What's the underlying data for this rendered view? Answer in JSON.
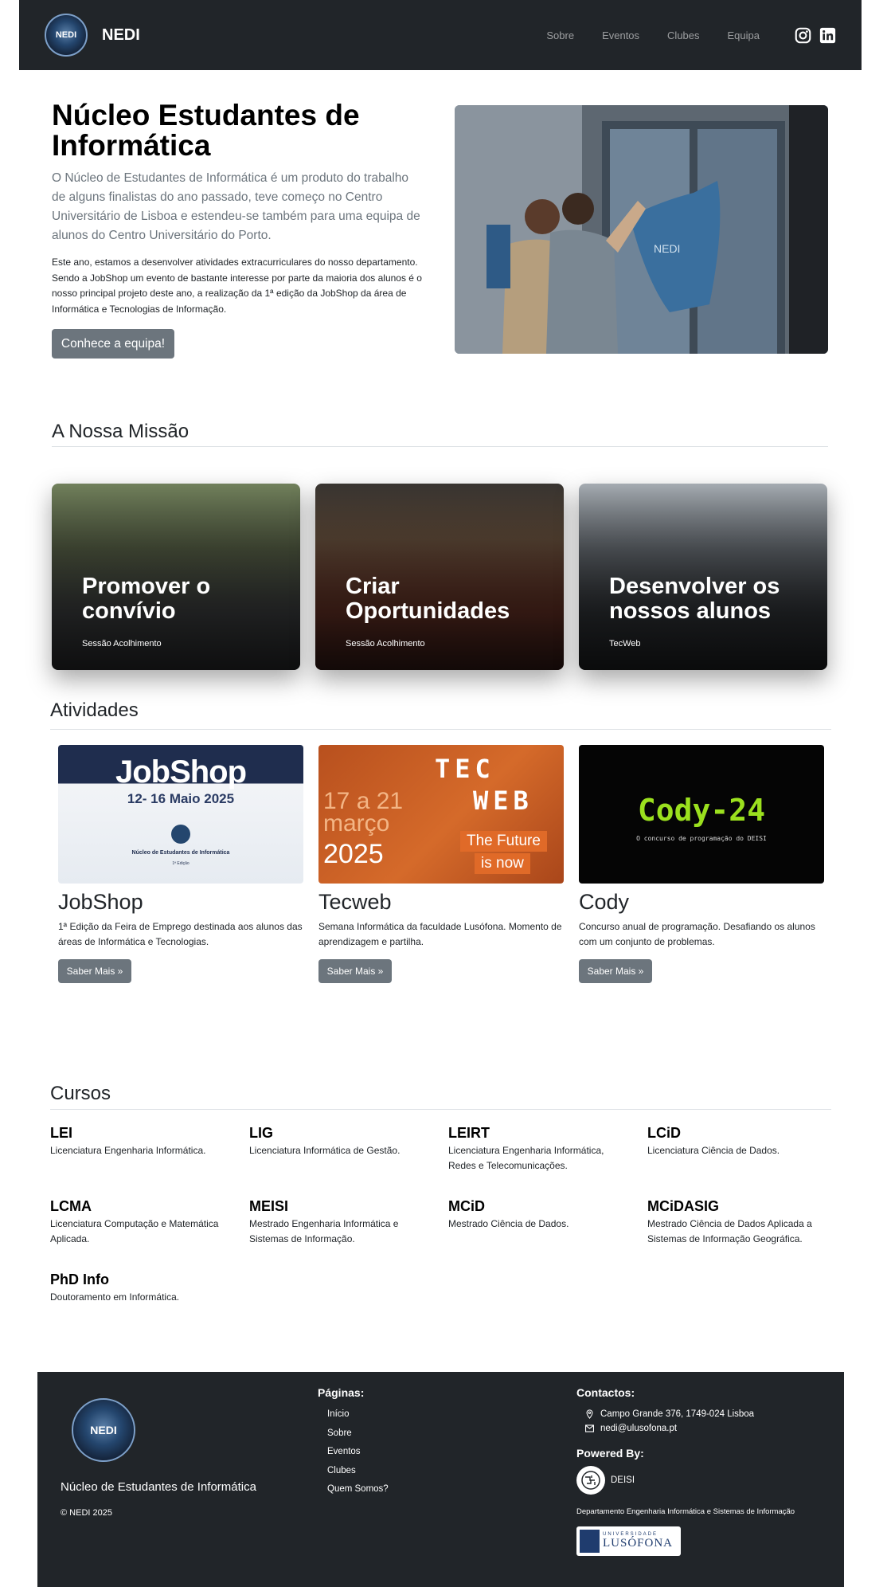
{
  "nav": {
    "logo_text": "NEDI",
    "brand": "NEDI",
    "links": [
      "Sobre",
      "Eventos",
      "Clubes",
      "Equipa"
    ],
    "social_icons": [
      "instagram-icon",
      "linkedin-icon"
    ]
  },
  "hero": {
    "title": "Núcleo Estudantes de Informática",
    "lead": "O Núcleo de Estudantes de Informática é um produto do trabalho de alguns finalistas do ano passado, teve começo no Centro Universitário de Lisboa e estendeu-se também para uma equipa de alunos do Centro Universitário do Porto.",
    "paragraph": "Este ano, estamos a desenvolver atividades extracurriculares do nosso departamento. Sendo a JobShop um evento de bastante interesse por parte da maioria dos alunos é o nosso principal projeto deste ano, a realização da 1ª edição da JobShop da área de Informática e Tecnologias de Informação.",
    "button": "Conhece a equipa!",
    "flag_text": "NEDI"
  },
  "mission": {
    "heading": "A Nossa Missão",
    "cards": [
      {
        "title": "Promover o convívio",
        "caption": "Sessão Acolhimento"
      },
      {
        "title": "Criar Oportunidades",
        "caption": "Sessão Acolhimento"
      },
      {
        "title": "Desenvolver os nossos alunos",
        "caption": "TecWeb"
      }
    ]
  },
  "activities": {
    "heading": "Atividades",
    "cards": [
      {
        "title": "JobShop",
        "desc": "1ª Edição da Feira de Emprego destinada aos alunos das áreas de Informática e Tecnologias.",
        "button": "Saber Mais »"
      },
      {
        "title": "Tecweb",
        "desc": "Semana Informática da faculdade Lusófona. Momento de aprendizagem e partilha.",
        "button": "Saber Mais »"
      },
      {
        "title": "Cody",
        "desc": "Concurso anual de programação. Desafiando os alunos com um conjunto de problemas.",
        "button": "Saber Mais »"
      }
    ],
    "jobshop_img": {
      "title": "JobShop",
      "dates": "12- 16 Maio 2025",
      "org": "Núcleo de Estudantes de Informática",
      "edition": "1ª Edição"
    },
    "tecweb_img": {
      "dates_line1": "17 a 21",
      "dates_line2": "março",
      "year": "2025",
      "tagline1": "The Future",
      "tagline2": "is now",
      "logo_top": "TEC",
      "logo_bottom": "WEB"
    },
    "cody_img": {
      "title": "Cody-24",
      "subtitle": "O concurso de programação do DEISI"
    }
  },
  "courses": {
    "heading": "Cursos",
    "items": [
      {
        "code": "LEI",
        "name": "Licenciatura Engenharia Informática."
      },
      {
        "code": "LIG",
        "name": "Licenciatura Informática de Gestão."
      },
      {
        "code": "LEIRT",
        "name": "Licenciatura Engenharia Informática, Redes e Telecomunicações."
      },
      {
        "code": "LCiD",
        "name": "Licenciatura Ciência de Dados."
      },
      {
        "code": "LCMA",
        "name": "Licenciatura Computação e Matemática Aplicada."
      },
      {
        "code": "MEISI",
        "name": "Mestrado Engenharia Informática e Sistemas de Informação."
      },
      {
        "code": "MCiD",
        "name": "Mestrado Ciência de Dados."
      },
      {
        "code": "MCiDASIG",
        "name": "Mestrado Ciência de Dados Aplicada a Sistemas de Informação Geográfica."
      },
      {
        "code": "PhD Info",
        "name": "Doutoramento em Informática."
      }
    ]
  },
  "footer": {
    "logo_text": "NEDI",
    "name": "Núcleo de Estudantes de Informática",
    "copyright": "© NEDI 2025",
    "pages_heading": "Páginas:",
    "pages": [
      "Início",
      "Sobre",
      "Eventos",
      "Clubes",
      "Quem Somos?"
    ],
    "contacts_heading": "Contactos:",
    "address": "Campo Grande 376, 1749-024 Lisboa",
    "email": "nedi@ulusofona.pt",
    "powered_heading": "Powered By:",
    "powered_name": "DEISI",
    "department": "Departamento Engenharia Informática e Sistemas de Informação",
    "university_small": "UNIVERSIDADE",
    "university": "LUSÓFONA"
  }
}
